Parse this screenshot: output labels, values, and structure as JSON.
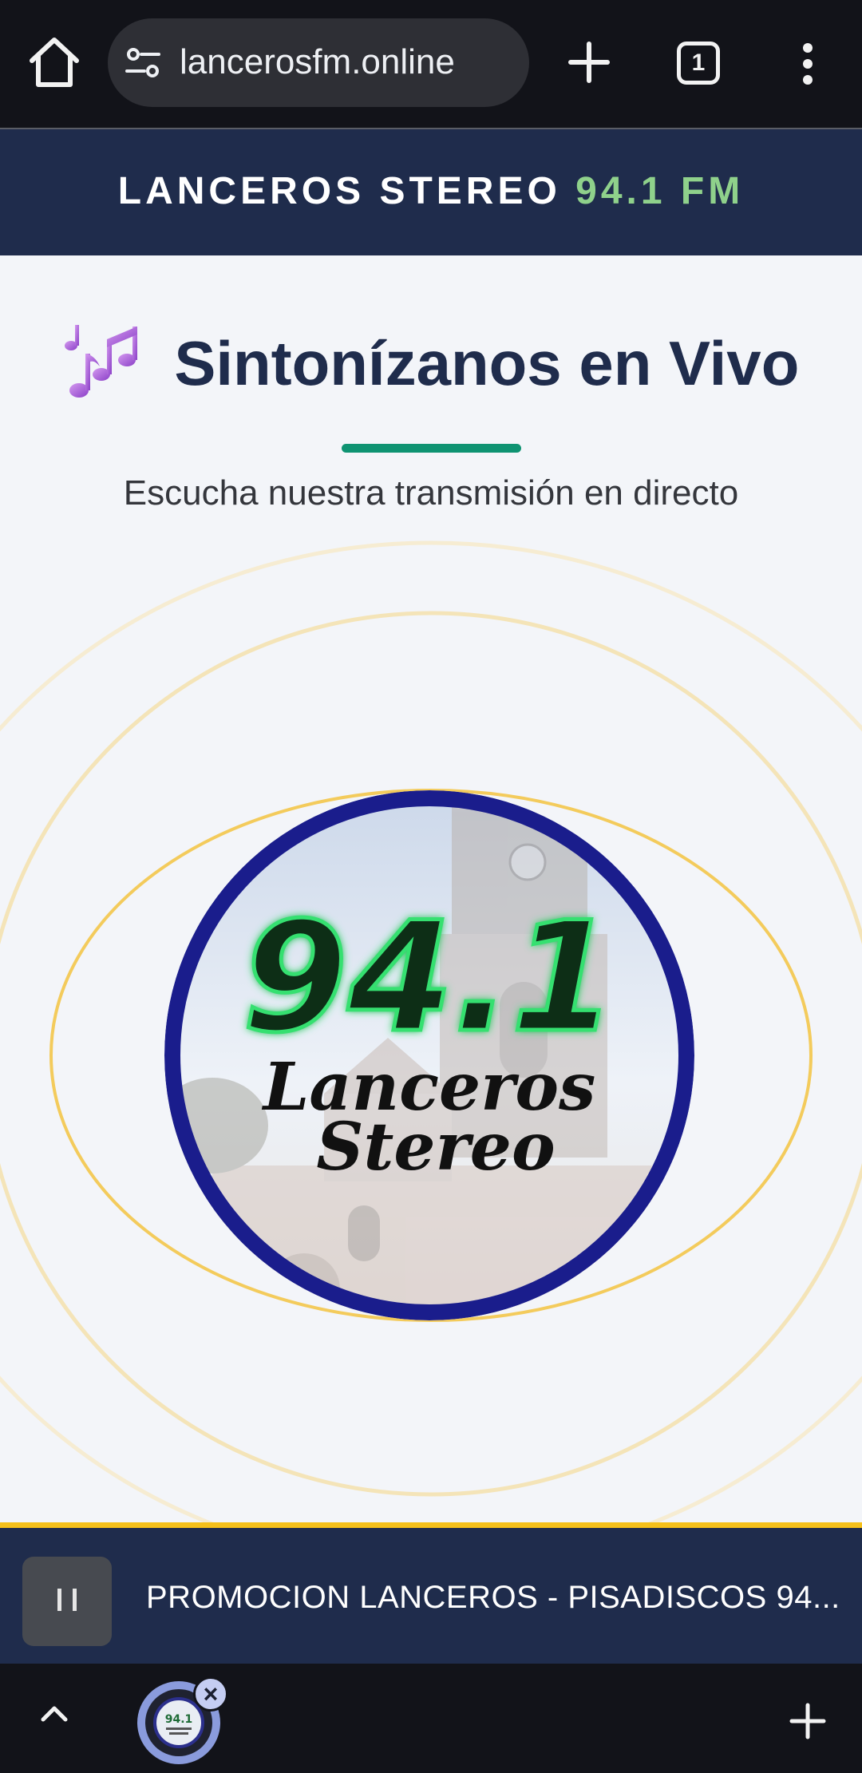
{
  "browser": {
    "url": "lancerosfm.online",
    "tab_count": "1",
    "icons": [
      "home-icon",
      "site-info-icon",
      "plus-icon",
      "tab-switcher-icon",
      "more-vert-icon"
    ]
  },
  "site": {
    "header_name": "LANCEROS STEREO",
    "header_frequency": "94.1 FM",
    "page_title": "Sintonízanos en Vivo",
    "subtitle": "Escucha nuestra transmisión en directo",
    "logo": {
      "frequency": "94.1",
      "name_line1": "Lanceros",
      "name_line2": "Stereo"
    }
  },
  "player": {
    "now_playing": "PROMOCION LANCEROS - PISADISCOS 94...",
    "state": "playing"
  },
  "bottom_bar": {
    "thumb_label": "94.1"
  },
  "colors": {
    "header_bg": "#1f2c4c",
    "accent_green": "#8fd18b",
    "underline_green": "#0e9372",
    "player_border": "#f5c01a",
    "logo_ring": "#1a1d8c",
    "ring_yellow": "#f3cb5c"
  }
}
